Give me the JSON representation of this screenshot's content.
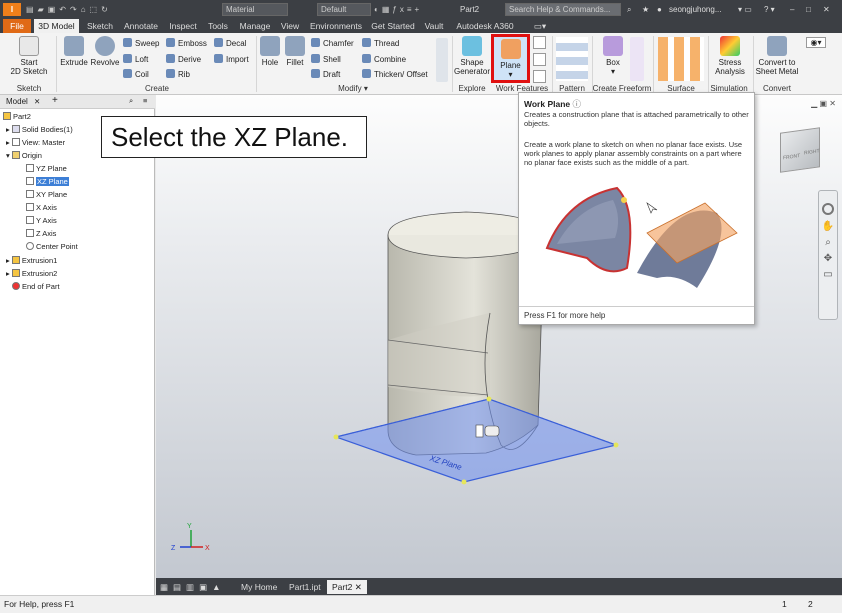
{
  "titlebar": {
    "app_letter": "I",
    "pro": "PRO",
    "material": "Material",
    "appearance": "Default",
    "doc_title": "Part2",
    "search_placeholder": "Search Help & Commands...",
    "user": "seongjuhong...",
    "controls": [
      "–",
      "□",
      "✕"
    ]
  },
  "tabs": [
    "File",
    "3D Model",
    "Sketch",
    "Annotate",
    "Inspect",
    "Tools",
    "Manage",
    "View",
    "Environments",
    "Get Started",
    "Vault",
    "Autodesk A360"
  ],
  "ribbon": {
    "start_sketch": [
      "Start",
      "2D Sketch"
    ],
    "extrude": "Extrude",
    "revolve": "Revolve",
    "sweep": "Sweep",
    "emboss": "Emboss",
    "decal": "Decal",
    "loft": "Loft",
    "derive": "Derive",
    "import": "Import",
    "coil": "Coil",
    "rib": "Rib",
    "hole": "Hole",
    "fillet": "Fillet",
    "chamfer": "Chamfer",
    "thread": "Thread",
    "shell": "Shell",
    "combine": "Combine",
    "draft": "Draft",
    "thicken": "Thicken/ Offset",
    "shape_gen": [
      "Shape",
      "Generator"
    ],
    "plane": "Plane",
    "box": "Box",
    "stress": [
      "Stress",
      "Analysis"
    ],
    "convert": [
      "Convert to",
      "Sheet Metal"
    ],
    "groups": [
      "Sketch",
      "Create",
      "Modify",
      "Explore",
      "Work Features",
      "Pattern",
      "Create Freeform",
      "Surface",
      "Simulation",
      "Convert"
    ]
  },
  "browser": {
    "tab": "Model",
    "close": "✕",
    "add": "+",
    "nodes": [
      "Part2",
      "Solid Bodies(1)",
      "View: Master",
      "Origin",
      "YZ Plane",
      "XZ Plane",
      "XY Plane",
      "X Axis",
      "Y Axis",
      "Z Axis",
      "Center Point",
      "Extrusion1",
      "Extrusion2",
      "End of Part"
    ]
  },
  "callout": "Select the XZ Plane.",
  "tooltip": {
    "title": "Work Plane",
    "line1": "Creates a construction plane that is attached parametrically to other objects.",
    "line2": "Create a work plane to sketch on when no planar face exists. Use work planes to apply planar assembly constraints on a part where no planar face exists such as the middle of a part.",
    "footer": "Press F1 for more help"
  },
  "viewport": {
    "plane_label": "XZ Plane",
    "viewcube": [
      "FRONT",
      "RIGHT"
    ]
  },
  "bottom_tabs": [
    "My Home",
    "Part1.ipt",
    "Part2"
  ],
  "status": {
    "help": "For Help, press F1",
    "n1": "1",
    "n2": "2"
  },
  "colors": {
    "accent": "#e06a16",
    "highlight": "#e01010",
    "plane_fill": "#6f8ff0",
    "selection": "#3d7fd6"
  }
}
